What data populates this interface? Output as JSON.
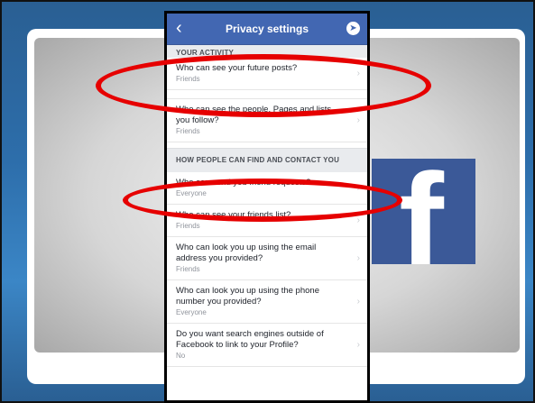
{
  "header": {
    "title": "Privacy settings"
  },
  "sections": [
    {
      "title": "YOUR ACTIVITY",
      "rows": [
        {
          "question": "Who can see your future posts?",
          "value": "Friends"
        },
        {
          "question": "Who can see the people, Pages and lists you follow?",
          "value": "Friends"
        }
      ]
    },
    {
      "title": "HOW PEOPLE CAN FIND AND CONTACT YOU",
      "rows": [
        {
          "question": "Who can send you friend requests?",
          "value": "Everyone"
        },
        {
          "question": "Who can see your friends list?",
          "value": "Friends"
        },
        {
          "question": "Who can look you up using the email address you provided?",
          "value": "Friends"
        },
        {
          "question": "Who can look you up using the phone number you provided?",
          "value": "Everyone"
        },
        {
          "question": "Do you want search engines outside of Facebook to link to your Profile?",
          "value": "No"
        }
      ]
    }
  ],
  "icons": {
    "back": "chevron-left-icon",
    "messenger": "messenger-icon",
    "row_chevron": "chevron-right-icon",
    "logo": "facebook-logo"
  },
  "logo_letter": "f",
  "colors": {
    "nav": "#4267b2",
    "logo": "#3b5998",
    "highlight": "#e60000"
  }
}
